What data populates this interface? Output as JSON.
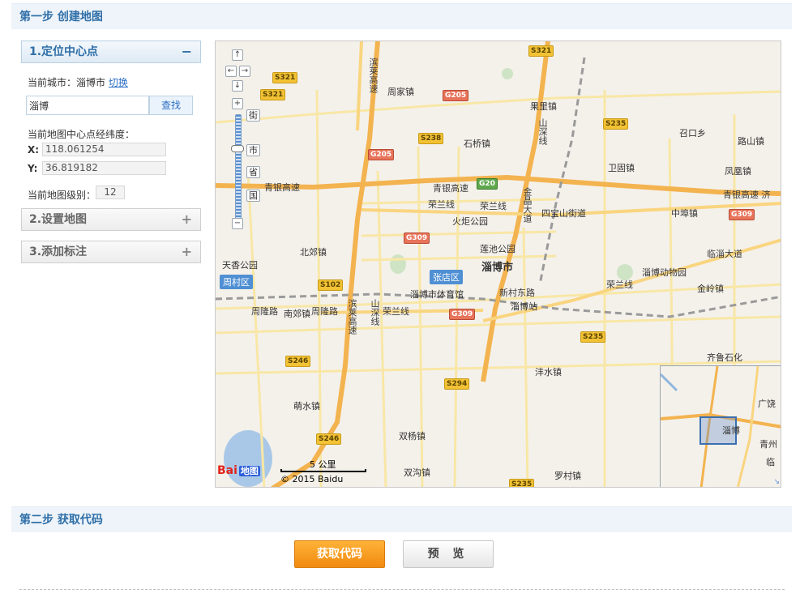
{
  "step1": {
    "title": "第一步 创建地图"
  },
  "step2": {
    "title": "第二步 获取代码",
    "get_code_label": "获取代码",
    "preview_label": "预 览"
  },
  "panel": {
    "section1": {
      "label": "1.定位中心点",
      "toggle": "−"
    },
    "section2": {
      "label": "2.设置地图",
      "toggle": "+"
    },
    "section3": {
      "label": "3.添加标注",
      "toggle": "+"
    },
    "current_city_label": "当前城市：",
    "current_city": "淄博市",
    "switch_link": "切换",
    "search_value": "淄博",
    "search_button": "查找",
    "center_label": "当前地图中心点经纬度：",
    "x_label": "X:",
    "x_value": "118.061254",
    "y_label": "Y:",
    "y_value": "36.819182",
    "zoom_label": "当前地图级别：",
    "zoom_value": "12"
  },
  "map": {
    "nav": {
      "up": "↑",
      "left": "←",
      "right": "→",
      "down": "↓",
      "zoom_in": "+",
      "zoom_out": "−"
    },
    "level_marks": [
      "街",
      "市",
      "省",
      "国"
    ],
    "scale_label": "5 公里",
    "copyright": "© 2015 Baidu",
    "logo": "Bai",
    "logo_suffix": "地图",
    "places": {
      "zhoujia": "周家镇",
      "guoli": "果里镇",
      "shiqiao": "石桥镇",
      "zhaokou": "召口乡",
      "lushan": "路山镇",
      "weigu": "卫固镇",
      "fenghuang": "凤凰镇",
      "huocheng": "火炬公园",
      "sibao": "四宝山街道",
      "zhongbu": "中埠镇",
      "beijiao": "北郊镇",
      "lianchi": "莲池公园",
      "zibo_city": "淄博市",
      "tianxiang": "天香公园",
      "zhangdian": "张店区",
      "zhoucun": "周村区",
      "tiyuguan": "淄博市体育馆",
      "zibo_station": "淄博站",
      "zoo": "淄博动物园",
      "jinling": "金岭镇",
      "nanjiao": "南郊镇",
      "fushui": "沣水镇",
      "qilu": "齐鲁石化",
      "meng": "萌水镇",
      "shuangyang": "双杨镇",
      "shuanggou": "双沟镇",
      "luocun": "罗村镇"
    },
    "roads": {
      "qingyin1": "青银高速",
      "qingyin2": "青银高速",
      "qingyin3": "青银高速 济",
      "binlai": "滨莱高速",
      "binlai2": "滨莱高速",
      "rongla1": "荣兰线",
      "rongla2": "荣兰线",
      "rongla3": "荣兰线",
      "rongla4": "荣兰线",
      "shanshen": "山深线",
      "shanshen2": "山深线",
      "jinling_dadao": "金晶大道",
      "linzi": "临淄大道",
      "xincun": "新村东路",
      "zhoulong1": "周隆路",
      "zhoulong2": "周隆路"
    },
    "tags": {
      "s321a": "S321",
      "s321b": "S321",
      "s321c": "S321",
      "g205a": "G205",
      "g205b": "G205",
      "s238": "S238",
      "s235a": "S235",
      "s235b": "S235",
      "s235c": "S235",
      "g20": "G20",
      "g309a": "G309",
      "g309b": "G309",
      "g309c": "G309",
      "s102": "S102",
      "s246a": "S246",
      "s246b": "S246",
      "s294": "S294"
    },
    "overview": {
      "zibo": "淄博",
      "guangrao": "广饶",
      "qingzhou": "青州",
      "linqu": "临"
    }
  },
  "colors": {
    "accent": "#2f6fa8",
    "orange_button": "#f18a10",
    "highway": "#f0a94a"
  }
}
